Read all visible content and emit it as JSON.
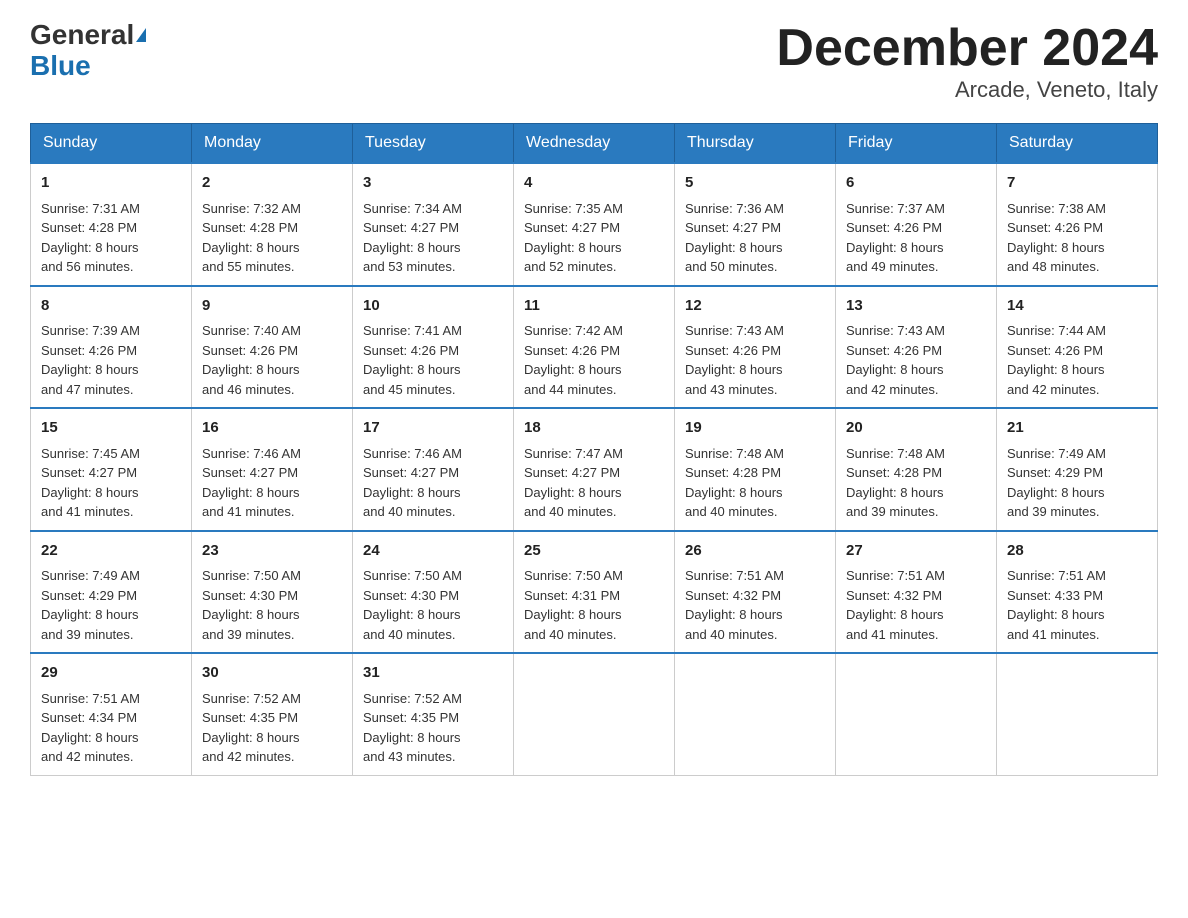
{
  "header": {
    "logo_general": "General",
    "logo_blue": "Blue",
    "title": "December 2024",
    "subtitle": "Arcade, Veneto, Italy"
  },
  "days_of_week": [
    "Sunday",
    "Monday",
    "Tuesday",
    "Wednesday",
    "Thursday",
    "Friday",
    "Saturday"
  ],
  "weeks": [
    [
      {
        "day": "1",
        "sunrise": "7:31 AM",
        "sunset": "4:28 PM",
        "daylight": "8 hours and 56 minutes."
      },
      {
        "day": "2",
        "sunrise": "7:32 AM",
        "sunset": "4:28 PM",
        "daylight": "8 hours and 55 minutes."
      },
      {
        "day": "3",
        "sunrise": "7:34 AM",
        "sunset": "4:27 PM",
        "daylight": "8 hours and 53 minutes."
      },
      {
        "day": "4",
        "sunrise": "7:35 AM",
        "sunset": "4:27 PM",
        "daylight": "8 hours and 52 minutes."
      },
      {
        "day": "5",
        "sunrise": "7:36 AM",
        "sunset": "4:27 PM",
        "daylight": "8 hours and 50 minutes."
      },
      {
        "day": "6",
        "sunrise": "7:37 AM",
        "sunset": "4:26 PM",
        "daylight": "8 hours and 49 minutes."
      },
      {
        "day": "7",
        "sunrise": "7:38 AM",
        "sunset": "4:26 PM",
        "daylight": "8 hours and 48 minutes."
      }
    ],
    [
      {
        "day": "8",
        "sunrise": "7:39 AM",
        "sunset": "4:26 PM",
        "daylight": "8 hours and 47 minutes."
      },
      {
        "day": "9",
        "sunrise": "7:40 AM",
        "sunset": "4:26 PM",
        "daylight": "8 hours and 46 minutes."
      },
      {
        "day": "10",
        "sunrise": "7:41 AM",
        "sunset": "4:26 PM",
        "daylight": "8 hours and 45 minutes."
      },
      {
        "day": "11",
        "sunrise": "7:42 AM",
        "sunset": "4:26 PM",
        "daylight": "8 hours and 44 minutes."
      },
      {
        "day": "12",
        "sunrise": "7:43 AM",
        "sunset": "4:26 PM",
        "daylight": "8 hours and 43 minutes."
      },
      {
        "day": "13",
        "sunrise": "7:43 AM",
        "sunset": "4:26 PM",
        "daylight": "8 hours and 42 minutes."
      },
      {
        "day": "14",
        "sunrise": "7:44 AM",
        "sunset": "4:26 PM",
        "daylight": "8 hours and 42 minutes."
      }
    ],
    [
      {
        "day": "15",
        "sunrise": "7:45 AM",
        "sunset": "4:27 PM",
        "daylight": "8 hours and 41 minutes."
      },
      {
        "day": "16",
        "sunrise": "7:46 AM",
        "sunset": "4:27 PM",
        "daylight": "8 hours and 41 minutes."
      },
      {
        "day": "17",
        "sunrise": "7:46 AM",
        "sunset": "4:27 PM",
        "daylight": "8 hours and 40 minutes."
      },
      {
        "day": "18",
        "sunrise": "7:47 AM",
        "sunset": "4:27 PM",
        "daylight": "8 hours and 40 minutes."
      },
      {
        "day": "19",
        "sunrise": "7:48 AM",
        "sunset": "4:28 PM",
        "daylight": "8 hours and 40 minutes."
      },
      {
        "day": "20",
        "sunrise": "7:48 AM",
        "sunset": "4:28 PM",
        "daylight": "8 hours and 39 minutes."
      },
      {
        "day": "21",
        "sunrise": "7:49 AM",
        "sunset": "4:29 PM",
        "daylight": "8 hours and 39 minutes."
      }
    ],
    [
      {
        "day": "22",
        "sunrise": "7:49 AM",
        "sunset": "4:29 PM",
        "daylight": "8 hours and 39 minutes."
      },
      {
        "day": "23",
        "sunrise": "7:50 AM",
        "sunset": "4:30 PM",
        "daylight": "8 hours and 39 minutes."
      },
      {
        "day": "24",
        "sunrise": "7:50 AM",
        "sunset": "4:30 PM",
        "daylight": "8 hours and 40 minutes."
      },
      {
        "day": "25",
        "sunrise": "7:50 AM",
        "sunset": "4:31 PM",
        "daylight": "8 hours and 40 minutes."
      },
      {
        "day": "26",
        "sunrise": "7:51 AM",
        "sunset": "4:32 PM",
        "daylight": "8 hours and 40 minutes."
      },
      {
        "day": "27",
        "sunrise": "7:51 AM",
        "sunset": "4:32 PM",
        "daylight": "8 hours and 41 minutes."
      },
      {
        "day": "28",
        "sunrise": "7:51 AM",
        "sunset": "4:33 PM",
        "daylight": "8 hours and 41 minutes."
      }
    ],
    [
      {
        "day": "29",
        "sunrise": "7:51 AM",
        "sunset": "4:34 PM",
        "daylight": "8 hours and 42 minutes."
      },
      {
        "day": "30",
        "sunrise": "7:52 AM",
        "sunset": "4:35 PM",
        "daylight": "8 hours and 42 minutes."
      },
      {
        "day": "31",
        "sunrise": "7:52 AM",
        "sunset": "4:35 PM",
        "daylight": "8 hours and 43 minutes."
      },
      null,
      null,
      null,
      null
    ]
  ],
  "labels": {
    "sunrise": "Sunrise:",
    "sunset": "Sunset:",
    "daylight": "Daylight:"
  }
}
